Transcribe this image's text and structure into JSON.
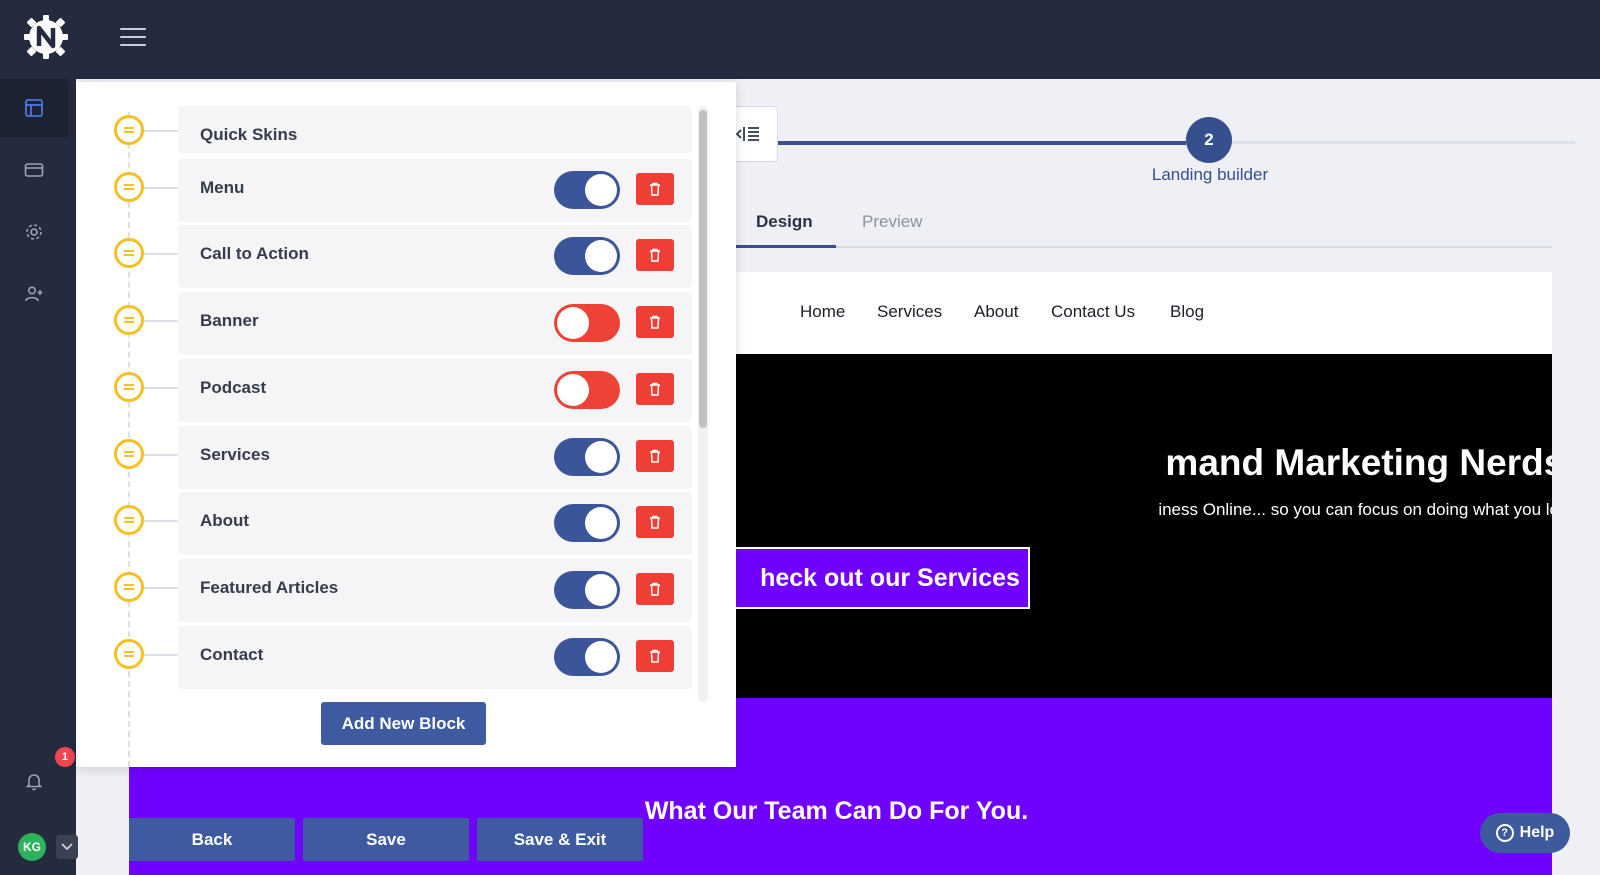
{
  "sidebar": {
    "notification_count": "1",
    "user_initials": "KG"
  },
  "stepper": {
    "step_number": "2",
    "step_label": "Landing builder"
  },
  "tabs": {
    "design": "Design",
    "preview": "Preview"
  },
  "site_nav": [
    "Home",
    "Services",
    "About",
    "Contact Us",
    "Blog"
  ],
  "hero": {
    "title": "mand Marketing Nerds.",
    "subtitle": "iness Online... so you can focus on doing what you love.",
    "cta": "heck out our Services"
  },
  "section": {
    "title": "What Our Team Can Do For You."
  },
  "actions": {
    "back": "Back",
    "save": "Save",
    "save_exit": "Save & Exit",
    "help": "Help"
  },
  "panel": {
    "blocks": [
      {
        "label": "Quick Skins",
        "toggle": null
      },
      {
        "label": "Menu",
        "toggle": "on"
      },
      {
        "label": "Call to Action",
        "toggle": "on"
      },
      {
        "label": "Banner",
        "toggle": "off"
      },
      {
        "label": "Podcast",
        "toggle": "off"
      },
      {
        "label": "Services",
        "toggle": "on"
      },
      {
        "label": "About",
        "toggle": "on"
      },
      {
        "label": "Featured Articles",
        "toggle": "on"
      },
      {
        "label": "Contact",
        "toggle": "on"
      }
    ],
    "add_block": "Add New Block"
  },
  "colors": {
    "navy": "#252b3e",
    "primary": "#3e5aa0",
    "toggle_on": "#3a559a",
    "toggle_off": "#ef4236",
    "delete": "#ef3e36",
    "handle": "#f5c024",
    "hero_bg": "#000000",
    "brand_purple": "#7000ff"
  }
}
